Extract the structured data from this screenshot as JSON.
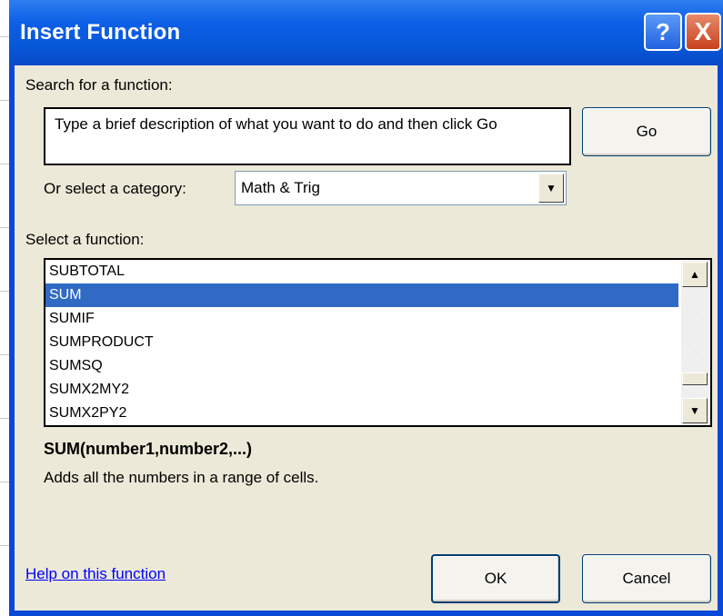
{
  "window": {
    "title": "Insert Function",
    "help_glyph": "?",
    "close_glyph": "X"
  },
  "search": {
    "label": "Search for a function:",
    "value": "Type a brief description of what you want to do and then click Go",
    "go_label": "Go"
  },
  "category": {
    "label": "Or select a category:",
    "value": "Math & Trig"
  },
  "functions": {
    "label": "Select a function:",
    "items": [
      "SUBTOTAL",
      "SUM",
      "SUMIF",
      "SUMPRODUCT",
      "SUMSQ",
      "SUMX2MY2",
      "SUMX2PY2"
    ],
    "selected": "SUM"
  },
  "details": {
    "signature": "SUM(number1,number2,...)",
    "description": "Adds all the numbers in a range of cells."
  },
  "footer": {
    "help_link": "Help on this function",
    "ok_label": "OK",
    "cancel_label": "Cancel"
  },
  "colors": {
    "titlebar": "#0756d6",
    "selection": "#316ac5",
    "dialog_bg": "#ece9d8"
  }
}
